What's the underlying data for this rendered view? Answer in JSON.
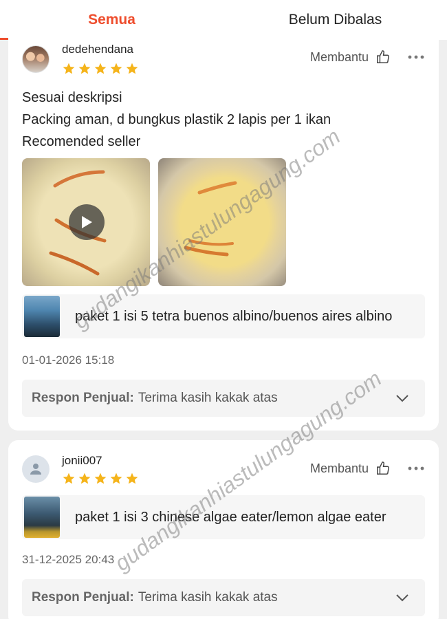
{
  "tabs": [
    {
      "label": "Semua",
      "active": true
    },
    {
      "label": "Belum Dibalas",
      "active": false
    }
  ],
  "reviews": [
    {
      "username": "dedehendana",
      "rating": 5,
      "helpful_label": "Membantu",
      "comment_lines": [
        "Sesuai deskripsi",
        "Packing aman, d bungkus plastik 2 lapis per 1 ikan",
        "Recomended seller"
      ],
      "media": [
        {
          "type": "video",
          "icon": "play-icon"
        },
        {
          "type": "photo"
        }
      ],
      "product_name": "paket 1 isi 5 tetra buenos albino/buenos aires albino",
      "date": "01-01-2026 15:18",
      "response_label": "Respon Penjual:",
      "response_text": "Terima kasih kakak atas"
    },
    {
      "username": "jonii007",
      "rating": 5,
      "helpful_label": "Membantu",
      "product_name": "paket 1 isi 3 chinese algae eater/lemon algae eater",
      "date": "31-12-2025 20:43",
      "response_label": "Respon Penjual:",
      "response_text": "Terima kasih kakak atas"
    }
  ],
  "watermark": "gudangikanhiastulungagung.com",
  "colors": {
    "accent": "#ee4d2d",
    "star": "#f5b41b"
  }
}
